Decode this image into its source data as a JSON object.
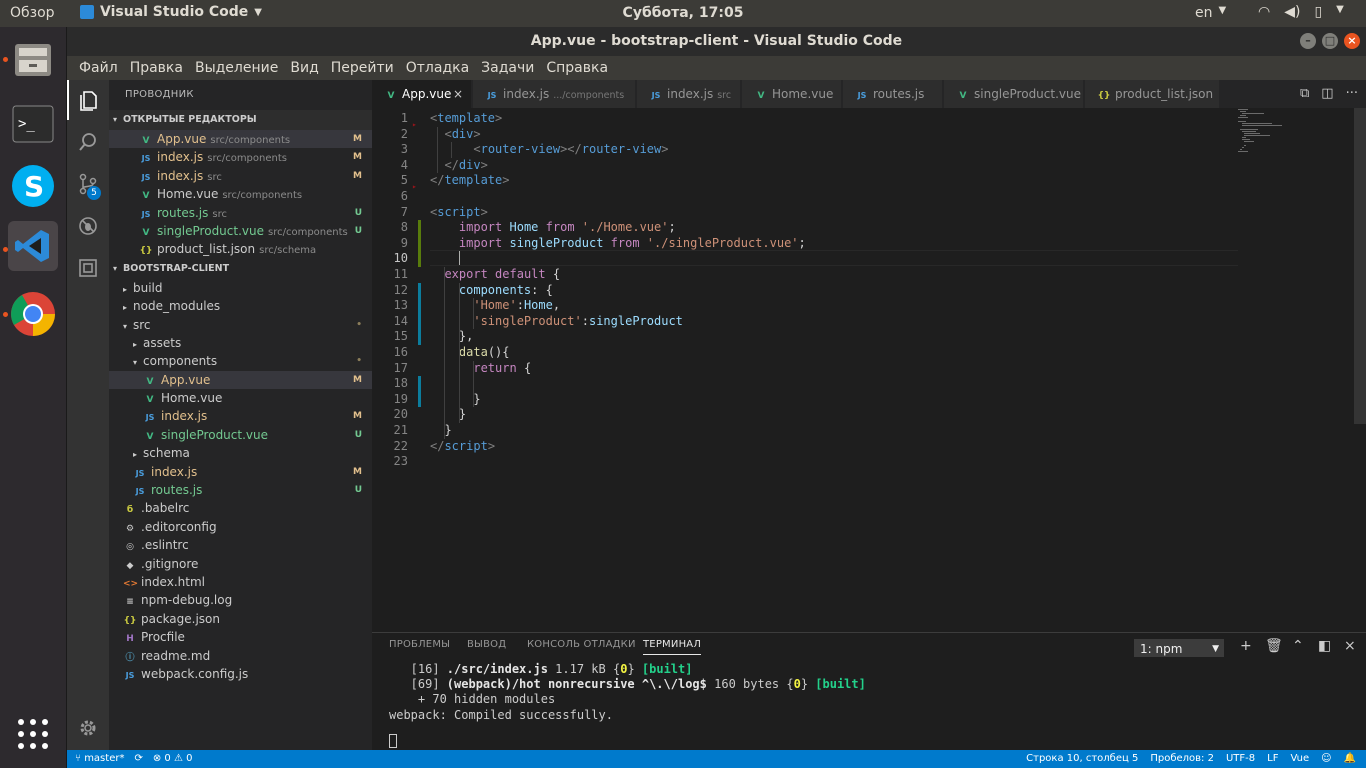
{
  "topbar": {
    "overview": "Обзор",
    "app_name": "Visual Studio Code",
    "clock": "Суббота, 17:05",
    "lang": "en"
  },
  "window": {
    "title": "App.vue - bootstrap-client - Visual Studio Code"
  },
  "menu": [
    "Файл",
    "Правка",
    "Выделение",
    "Вид",
    "Перейти",
    "Отладка",
    "Задачи",
    "Справка"
  ],
  "activity": {
    "scm_badge": "5"
  },
  "sidebar": {
    "title": "ПРОВОДНИК",
    "open_editors_title": "ОТКРЫТЫЕ РЕДАКТОРЫ",
    "open_editors": [
      {
        "name": "App.vue",
        "desc": "src/components",
        "badge": "M",
        "icon": "vue-icon"
      },
      {
        "name": "index.js",
        "desc": "src/components",
        "badge": "M",
        "icon": "js-icon"
      },
      {
        "name": "index.js",
        "desc": "src",
        "badge": "M",
        "icon": "js-icon"
      },
      {
        "name": "Home.vue",
        "desc": "src/components",
        "badge": "",
        "icon": "vue-icon"
      },
      {
        "name": "routes.js",
        "desc": "src",
        "badge": "U",
        "icon": "js-icon"
      },
      {
        "name": "singleProduct.vue",
        "desc": "src/components",
        "badge": "U",
        "icon": "vue-icon"
      },
      {
        "name": "product_list.json",
        "desc": "src/schema",
        "badge": "",
        "icon": "json-icon"
      }
    ],
    "project_title": "BOOTSTRAP-CLIENT",
    "tree": [
      {
        "name": "build",
        "indent": 0,
        "arrow": "▸",
        "icon": "",
        "badge": ""
      },
      {
        "name": "node_modules",
        "indent": 0,
        "arrow": "▸",
        "icon": "",
        "badge": ""
      },
      {
        "name": "src",
        "indent": 0,
        "arrow": "▾",
        "icon": "",
        "badge": "•"
      },
      {
        "name": "assets",
        "indent": 1,
        "arrow": "▸",
        "icon": "",
        "badge": ""
      },
      {
        "name": "components",
        "indent": 1,
        "arrow": "▾",
        "icon": "",
        "badge": "•"
      },
      {
        "name": "App.vue",
        "indent": 2,
        "arrow": "",
        "icon": "vue-icon",
        "badge": "M"
      },
      {
        "name": "Home.vue",
        "indent": 2,
        "arrow": "",
        "icon": "vue-icon",
        "badge": ""
      },
      {
        "name": "index.js",
        "indent": 2,
        "arrow": "",
        "icon": "js-icon",
        "badge": "M"
      },
      {
        "name": "singleProduct.vue",
        "indent": 2,
        "arrow": "",
        "icon": "vue-icon",
        "badge": "U"
      },
      {
        "name": "schema",
        "indent": 1,
        "arrow": "▸",
        "icon": "",
        "badge": ""
      },
      {
        "name": "index.js",
        "indent": 1,
        "arrow": "",
        "icon": "js-icon",
        "badge": "M"
      },
      {
        "name": "routes.js",
        "indent": 1,
        "arrow": "",
        "icon": "js-icon",
        "badge": "U"
      },
      {
        "name": ".babelrc",
        "indent": 0,
        "arrow": "",
        "icon": "babel-icon",
        "badge": ""
      },
      {
        "name": ".editorconfig",
        "indent": 0,
        "arrow": "",
        "icon": "gear-icon",
        "badge": ""
      },
      {
        "name": ".eslintrc",
        "indent": 0,
        "arrow": "",
        "icon": "eslint-icon",
        "badge": ""
      },
      {
        "name": ".gitignore",
        "indent": 0,
        "arrow": "",
        "icon": "git-icon",
        "badge": ""
      },
      {
        "name": "index.html",
        "indent": 0,
        "arrow": "",
        "icon": "html-icon",
        "badge": ""
      },
      {
        "name": "npm-debug.log",
        "indent": 0,
        "arrow": "",
        "icon": "log-icon",
        "badge": ""
      },
      {
        "name": "package.json",
        "indent": 0,
        "arrow": "",
        "icon": "json-icon",
        "badge": ""
      },
      {
        "name": "Procfile",
        "indent": 0,
        "arrow": "",
        "icon": "heroku-icon",
        "badge": ""
      },
      {
        "name": "readme.md",
        "indent": 0,
        "arrow": "",
        "icon": "info-icon",
        "badge": ""
      },
      {
        "name": "webpack.config.js",
        "indent": 0,
        "arrow": "",
        "icon": "js-icon",
        "badge": ""
      }
    ]
  },
  "tabs": [
    {
      "name": "App.vue",
      "desc": "",
      "icon": "vue-icon"
    },
    {
      "name": "index.js",
      "desc": ".../components",
      "icon": "js-icon"
    },
    {
      "name": "index.js",
      "desc": "src",
      "icon": "js-icon"
    },
    {
      "name": "Home.vue",
      "desc": "",
      "icon": "vue-icon"
    },
    {
      "name": "routes.js",
      "desc": "",
      "icon": "js-icon"
    },
    {
      "name": "singleProduct.vue",
      "desc": "",
      "icon": "vue-icon"
    },
    {
      "name": "product_list.json",
      "desc": "",
      "icon": "json-icon"
    }
  ],
  "editor": {
    "active_line": 10,
    "lines": [
      [
        [
          "<",
          "t-punc"
        ],
        [
          "template",
          "t-tag"
        ],
        [
          ">",
          "t-punc"
        ]
      ],
      [
        [
          "  ",
          ""
        ],
        [
          "<",
          "t-punc"
        ],
        [
          "div",
          "t-tag"
        ],
        [
          ">",
          "t-punc"
        ]
      ],
      [
        [
          "      ",
          ""
        ],
        [
          "<",
          "t-punc"
        ],
        [
          "router-view",
          "t-tag"
        ],
        [
          "></",
          "t-punc"
        ],
        [
          "router-view",
          "t-tag"
        ],
        [
          ">",
          "t-punc"
        ]
      ],
      [
        [
          "  ",
          ""
        ],
        [
          "</",
          "t-punc"
        ],
        [
          "div",
          "t-tag"
        ],
        [
          ">",
          "t-punc"
        ]
      ],
      [
        [
          "</",
          "t-punc"
        ],
        [
          "template",
          "t-tag"
        ],
        [
          ">",
          "t-punc"
        ]
      ],
      [],
      [
        [
          "<",
          "t-punc"
        ],
        [
          "script",
          "t-tag"
        ],
        [
          ">",
          "t-punc"
        ]
      ],
      [
        [
          "    ",
          ""
        ],
        [
          "import",
          "t-kw"
        ],
        [
          " ",
          ""
        ],
        [
          "Home",
          "t-var"
        ],
        [
          " ",
          ""
        ],
        [
          "from",
          "t-kw"
        ],
        [
          " ",
          ""
        ],
        [
          "'./Home.vue'",
          "t-str"
        ],
        [
          ";",
          ""
        ]
      ],
      [
        [
          "    ",
          ""
        ],
        [
          "import",
          "t-kw"
        ],
        [
          " ",
          ""
        ],
        [
          "singleProduct",
          "t-var"
        ],
        [
          " ",
          ""
        ],
        [
          "from",
          "t-kw"
        ],
        [
          " ",
          ""
        ],
        [
          "'./singleProduct.vue'",
          "t-str"
        ],
        [
          ";",
          ""
        ]
      ],
      [
        [
          "    ",
          ""
        ]
      ],
      [
        [
          "  ",
          ""
        ],
        [
          "export",
          "t-kw"
        ],
        [
          " ",
          ""
        ],
        [
          "default",
          "t-kw"
        ],
        [
          " {",
          ""
        ]
      ],
      [
        [
          "    ",
          ""
        ],
        [
          "components",
          "t-var"
        ],
        [
          ": {",
          ""
        ]
      ],
      [
        [
          "      ",
          ""
        ],
        [
          "'Home'",
          "t-str"
        ],
        [
          ":",
          ""
        ],
        [
          "Home",
          "t-var"
        ],
        [
          ",",
          ""
        ]
      ],
      [
        [
          "      ",
          ""
        ],
        [
          "'singleProduct'",
          "t-str"
        ],
        [
          ":",
          ""
        ],
        [
          "singleProduct",
          "t-var"
        ]
      ],
      [
        [
          "    ",
          ""
        ],
        [
          "},",
          ""
        ]
      ],
      [
        [
          "    ",
          ""
        ],
        [
          "data",
          "t-fn"
        ],
        [
          "(){",
          ""
        ]
      ],
      [
        [
          "      ",
          ""
        ],
        [
          "return",
          "t-kw"
        ],
        [
          " {",
          ""
        ]
      ],
      [],
      [
        [
          "      ",
          ""
        ],
        [
          "}",
          ""
        ]
      ],
      [
        [
          "    ",
          ""
        ],
        [
          "}",
          ""
        ]
      ],
      [
        [
          "  ",
          ""
        ],
        [
          "}",
          ""
        ]
      ],
      [
        [
          "</",
          "t-punc"
        ],
        [
          "script",
          "t-tag"
        ],
        [
          ">",
          "t-punc"
        ]
      ],
      []
    ]
  },
  "panel": {
    "tabs": [
      "ПРОБЛЕМЫ",
      "ВЫВОД",
      "КОНСОЛЬ ОТЛАДКИ",
      "ТЕРМИНАЛ"
    ],
    "terminal_select": "1: npm",
    "terminal_lines": [
      [
        [
          "   [16] ",
          ""
        ],
        [
          "./src/index.js",
          "tb"
        ],
        [
          " 1.17 kB {",
          ""
        ],
        [
          "0",
          "ty"
        ],
        [
          "} ",
          ""
        ],
        [
          "[built]",
          "tg"
        ]
      ],
      [
        [
          "   [69] ",
          ""
        ],
        [
          "(webpack)/hot nonrecursive ^\\.\\/log$",
          "tb"
        ],
        [
          " 160 bytes {",
          ""
        ],
        [
          "0",
          "ty"
        ],
        [
          "} ",
          ""
        ],
        [
          "[built]",
          "tg"
        ]
      ],
      [
        [
          "    + 70 hidden modules",
          ""
        ]
      ],
      [
        [
          "webpack: Compiled successfully.",
          ""
        ]
      ]
    ]
  },
  "statusbar": {
    "branch": "master*",
    "errors": "0",
    "warnings": "0",
    "cursor": "Строка 10, столбец 5",
    "indent": "Пробелов: 2",
    "encoding": "UTF-8",
    "eol": "LF",
    "language": "Vue"
  }
}
